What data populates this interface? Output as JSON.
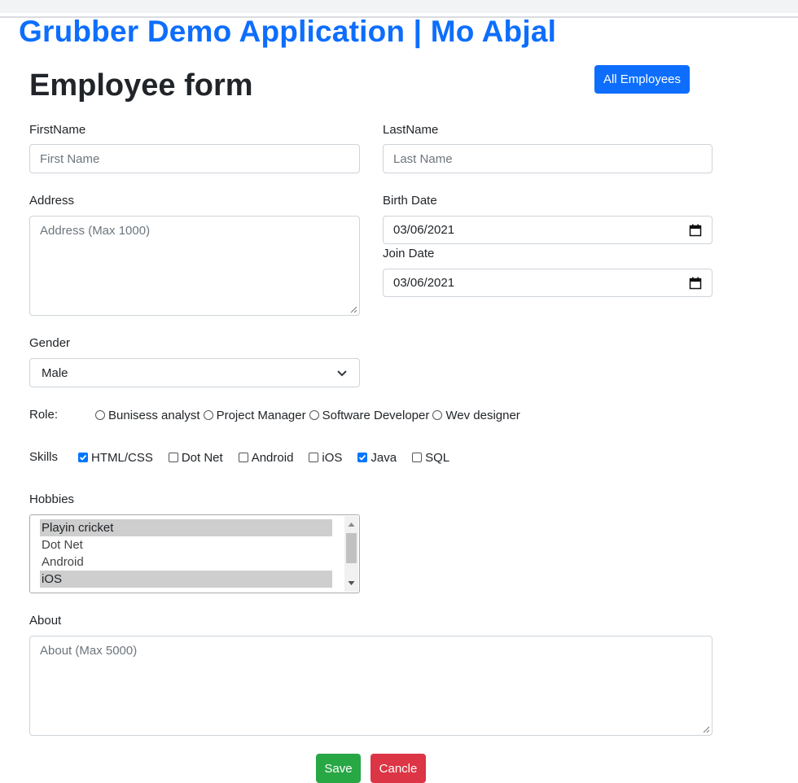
{
  "app": {
    "brand": "Grubber Demo Application | Mo Abjal"
  },
  "form": {
    "title": "Employee form",
    "all_employees_label": "All Employees",
    "first_name": {
      "label": "FirstName",
      "placeholder": "First Name",
      "value": ""
    },
    "last_name": {
      "label": "LastName",
      "placeholder": "Last Name",
      "value": ""
    },
    "address": {
      "label": "Address",
      "placeholder": "Address (Max 1000)",
      "value": ""
    },
    "birth_date": {
      "label": "Birth Date",
      "value": "03/06/2021"
    },
    "join_date": {
      "label": "Join Date",
      "value": "03/06/2021"
    },
    "gender": {
      "label": "Gender",
      "selected": "Male"
    },
    "role": {
      "label": "Role:",
      "options": [
        "Bunisess analyst",
        "Project Manager",
        "Software Developer",
        "Wev designer"
      ],
      "checked": []
    },
    "skills": {
      "label": "Skills",
      "options": [
        {
          "label": "HTML/CSS",
          "checked": true
        },
        {
          "label": "Dot Net",
          "checked": false
        },
        {
          "label": "Android",
          "checked": false
        },
        {
          "label": "iOS",
          "checked": false
        },
        {
          "label": "Java",
          "checked": true
        },
        {
          "label": "SQL",
          "checked": false
        }
      ]
    },
    "hobbies": {
      "label": "Hobbies",
      "items": [
        {
          "label": "Playin cricket",
          "selected": true
        },
        {
          "label": "Dot Net",
          "selected": false
        },
        {
          "label": "Android",
          "selected": false
        },
        {
          "label": "iOS",
          "selected": true
        }
      ]
    },
    "about": {
      "label": "About",
      "placeholder": "About (Max 5000)",
      "value": ""
    },
    "save_label": "Save",
    "cancel_label": "Cancle"
  },
  "colors": {
    "brand": "#0d6efd",
    "primary": "#0d6efd",
    "success": "#28a745",
    "danger": "#dc3545",
    "checkbox_checked": "#0075ff",
    "listbox_selected": "#cecece"
  }
}
